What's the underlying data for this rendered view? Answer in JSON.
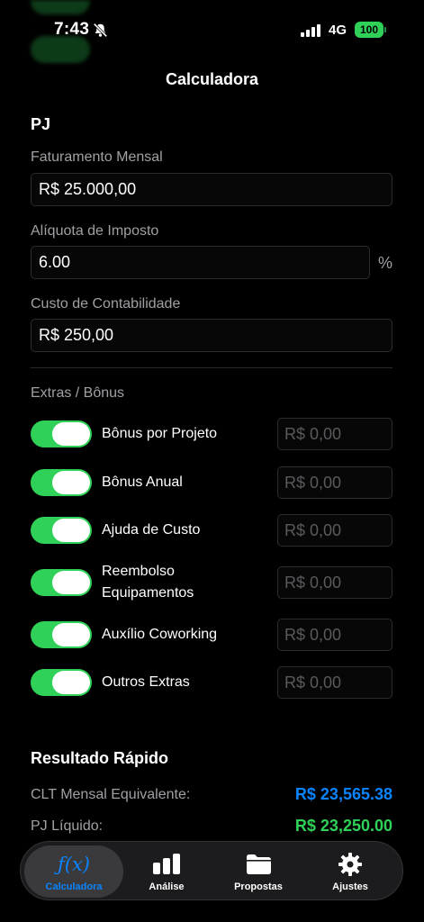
{
  "status_bar": {
    "time": "7:43",
    "network": "4G",
    "battery": "100"
  },
  "nav": {
    "title": "Calculadora"
  },
  "pj": {
    "section_title": "PJ",
    "faturamento": {
      "label": "Faturamento Mensal",
      "value": "R$ 25.000,00"
    },
    "aliquota": {
      "label": "Alíquota de Imposto",
      "value": "6.00",
      "unit": "%"
    },
    "contabilidade": {
      "label": "Custo de Contabilidade",
      "value": "R$ 250,00"
    }
  },
  "extras": {
    "title": "Extras / Bônus",
    "items": [
      {
        "label": "Bônus por Projeto",
        "placeholder": "R$ 0,00",
        "enabled": true
      },
      {
        "label": "Bônus Anual",
        "placeholder": "R$ 0,00",
        "enabled": true
      },
      {
        "label": "Ajuda de Custo",
        "placeholder": "R$ 0,00",
        "enabled": true
      },
      {
        "label": "Reembolso Equipamentos",
        "placeholder": "R$ 0,00",
        "enabled": true
      },
      {
        "label": "Auxílio Coworking",
        "placeholder": "R$ 0,00",
        "enabled": true
      },
      {
        "label": "Outros Extras",
        "placeholder": "R$ 0,00",
        "enabled": true
      }
    ]
  },
  "result": {
    "title": "Resultado Rápido",
    "clt": {
      "label": "CLT Mensal Equivalente:",
      "value": "R$ 23,565.38",
      "color": "#0a84ff"
    },
    "pj": {
      "label": "PJ Líquido:",
      "value": "R$ 23,250.00",
      "color": "#30d158"
    }
  },
  "tabs": [
    {
      "label": "Calculadora",
      "icon": "function-icon",
      "active": true
    },
    {
      "label": "Análise",
      "icon": "bar-chart-icon",
      "active": false
    },
    {
      "label": "Propostas",
      "icon": "folder-icon",
      "active": false
    },
    {
      "label": "Ajustes",
      "icon": "gear-icon",
      "active": false
    }
  ],
  "colors": {
    "accent": "#0a84ff",
    "toggle_on": "#30d158",
    "background": "#000000"
  }
}
